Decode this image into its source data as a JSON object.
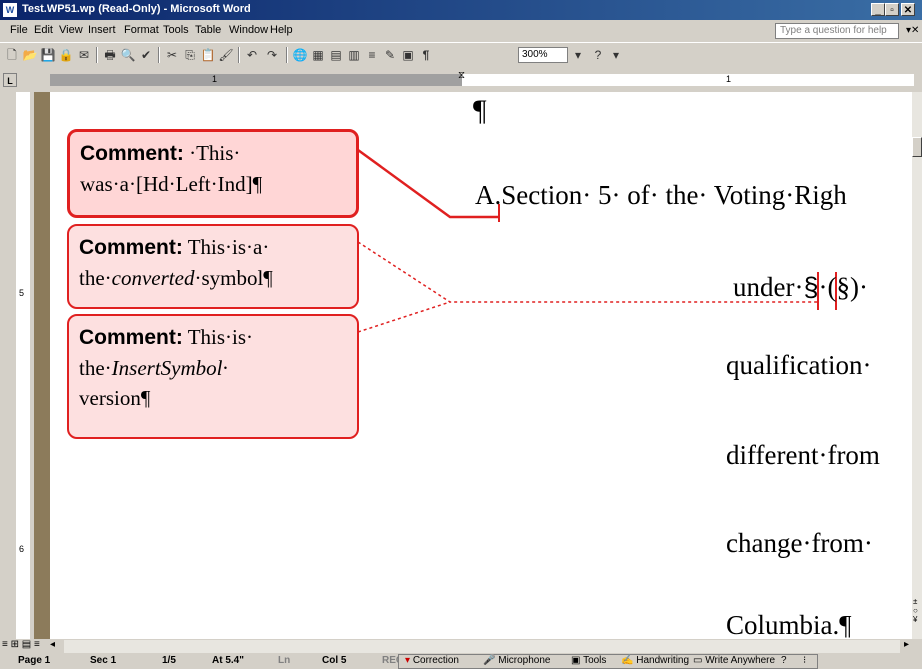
{
  "window": {
    "title": "Test.WP51.wp (Read-Only) - Microsoft Word",
    "app_icon": "W"
  },
  "menu": {
    "items": [
      "File",
      "Edit",
      "View",
      "Insert",
      "Format",
      "Tools",
      "Table",
      "Window",
      "Help"
    ],
    "help_placeholder": "Type a question for help"
  },
  "toolbar": {
    "zoom": "300%",
    "pilcrow": "¶"
  },
  "ruler": {
    "tab_selector": "L",
    "numbers": [
      "1",
      "1"
    ]
  },
  "vruler": {
    "numbers": [
      "5",
      "6"
    ]
  },
  "document": {
    "top_mark": "¶",
    "comments": [
      {
        "label": "Comment:",
        "parts": [
          {
            "t": " ·This·",
            "i": false
          },
          {
            "t": "was·a·[Hd·Left·Ind]¶",
            "i": false
          }
        ]
      },
      {
        "label": "Comment:",
        "parts": [
          {
            "t": " This·is·a·",
            "i": false
          },
          {
            "t": "the·",
            "i": false
          },
          {
            "t": "converted",
            "i": true
          },
          {
            "t": "·symbol¶",
            "i": false
          }
        ]
      },
      {
        "label": "Comment:",
        "parts": [
          {
            "t": " This·is·",
            "i": false
          },
          {
            "t": "the·",
            "i": false
          },
          {
            "t": "InsertSymbol·",
            "i": true
          },
          {
            "t": "version¶",
            "i": false
          }
        ]
      }
    ],
    "lines": {
      "l1": "A.Section· 5· of· the· Voting·Righ",
      "l2_pre": "under·",
      "l2_sym": "§",
      "l2_post": "·(§)·",
      "l3": "qualification·",
      "l4": "different·from",
      "l5": "change·from·",
      "l6": "Columbia.¶"
    }
  },
  "statusbar": {
    "page": "Page 1",
    "sec": "Sec 1",
    "pages": "1/5",
    "at": "At 5.4\"",
    "ln": "Ln",
    "col": "Col 5",
    "rec": "REC"
  },
  "langbar": {
    "items": [
      "Correction",
      "Microphone",
      "Tools",
      "Handwriting",
      "Write Anywhere"
    ]
  },
  "colors": {
    "title_bar": "#0a246a",
    "comment_border": "#e02020",
    "comment_fill": "#fde0e0",
    "margin": "#8c7b5b"
  }
}
